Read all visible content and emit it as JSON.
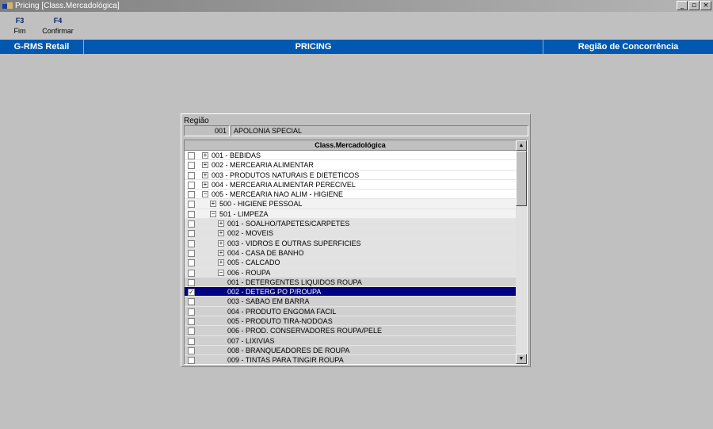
{
  "window": {
    "title": "Pricing [Class.Mercadológica]",
    "buttons": {
      "minimize": "_",
      "maximize": "▫",
      "close": "×"
    }
  },
  "toolbar": {
    "f3_key": "F3",
    "f3_label": "Fim",
    "f4_key": "F4",
    "f4_label": "Confirmar"
  },
  "header": {
    "left": "G-RMS Retail",
    "center": "PRICING",
    "right": "Região de Concorrência"
  },
  "dialog": {
    "region_label": "Região",
    "region_code": "001",
    "region_name": "APOLONIA SPECIAL",
    "tree_header": "Class.Mercadológica",
    "scroll_up": "▲",
    "scroll_down": "▼",
    "rows": [
      {
        "label": "001 - BEBIDAS",
        "level": 1,
        "expander": "+",
        "checked": false
      },
      {
        "label": "002 - MERCEARIA ALIMENTAR",
        "level": 1,
        "expander": "+",
        "checked": false
      },
      {
        "label": "003 - PRODUTOS NATURAIS E DIETETICOS",
        "level": 1,
        "expander": "+",
        "checked": false
      },
      {
        "label": "004 - MERCEARIA ALIMENTAR PERECIVEL",
        "level": 1,
        "expander": "+",
        "checked": false
      },
      {
        "label": "005 - MERCEARIA NAO ALIM - HIGIENE",
        "level": 1,
        "expander": "−",
        "checked": false
      },
      {
        "label": "500 - HIGIENE PESSOAL",
        "level": 2,
        "expander": "+",
        "checked": false
      },
      {
        "label": "501 - LIMPEZA",
        "level": 2,
        "expander": "−",
        "checked": false
      },
      {
        "label": "001 - SOALHO/TAPETES/CARPETES",
        "level": 3,
        "expander": "+",
        "checked": false
      },
      {
        "label": "002 - MOVEIS",
        "level": 3,
        "expander": "+",
        "checked": false
      },
      {
        "label": "003 - VIDROS E OUTRAS SUPERFICIES",
        "level": 3,
        "expander": "+",
        "checked": false
      },
      {
        "label": "004 - CASA DE BANHO",
        "level": 3,
        "expander": "+",
        "checked": false
      },
      {
        "label": "005 - CALCADO",
        "level": 3,
        "expander": "+",
        "checked": false
      },
      {
        "label": "006 - ROUPA",
        "level": 3,
        "expander": "−",
        "checked": false
      },
      {
        "label": "001 - DETERGENTES LIQUIDOS ROUPA",
        "level": 4,
        "expander": "",
        "checked": false
      },
      {
        "label": "002 - DETERG PO P/ROUPA",
        "level": 4,
        "expander": "",
        "checked": true,
        "selected": true
      },
      {
        "label": "003 - SABAO EM BARRA",
        "level": 4,
        "expander": "",
        "checked": false
      },
      {
        "label": "004 - PRODUTO ENGOMA FACIL",
        "level": 4,
        "expander": "",
        "checked": false
      },
      {
        "label": "005 - PRODUTO TIRA-NODOAS",
        "level": 4,
        "expander": "",
        "checked": false
      },
      {
        "label": "006 - PROD. CONSERVADORES ROUPA/PELE",
        "level": 4,
        "expander": "",
        "checked": false
      },
      {
        "label": "007 - LIXIVIAS",
        "level": 4,
        "expander": "",
        "checked": false
      },
      {
        "label": "008 - BRANQUEADORES DE ROUPA",
        "level": 4,
        "expander": "",
        "checked": false
      },
      {
        "label": "009 - TINTAS PARA TINGIR ROUPA",
        "level": 4,
        "expander": "",
        "checked": false
      }
    ]
  }
}
